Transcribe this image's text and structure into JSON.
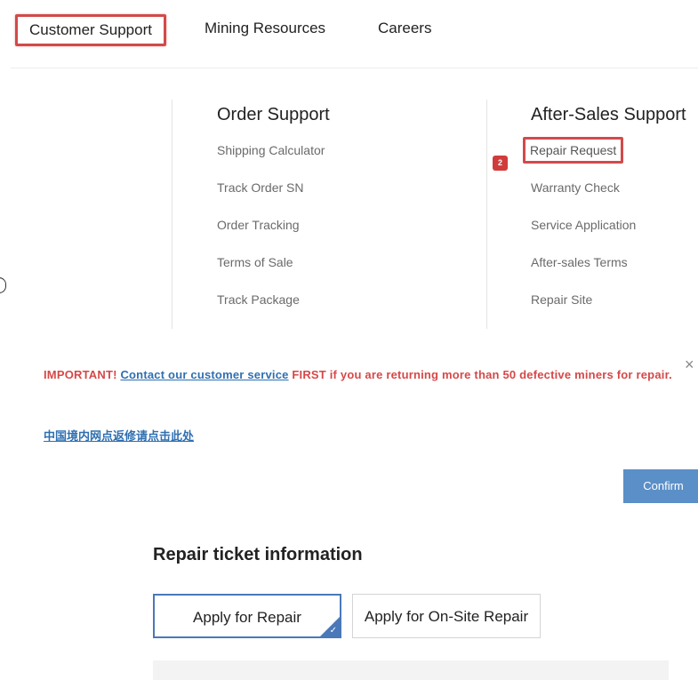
{
  "nav": {
    "items": [
      "Customer Support",
      "Mining Resources",
      "Careers"
    ]
  },
  "menu": {
    "order_support": {
      "title": "Order Support",
      "links": [
        "Shipping Calculator",
        "Track Order SN",
        "Order Tracking",
        "Terms of Sale",
        "Track Package"
      ]
    },
    "after_sales": {
      "title": "After-Sales Support",
      "links": [
        "Repair Request",
        "Warranty Check",
        "Service Application",
        "After-sales Terms",
        "Repair Site"
      ]
    },
    "step_badge": "2"
  },
  "notice": {
    "important_label": "IMPORTANT!",
    "link_text": "Contact our customer service",
    "rest_text": "FIRST if you are returning more than 50 defective miners for repair.",
    "close_glyph": "×",
    "cn_link": "中国境内网点返修请点击此处",
    "confirm_label": "Confirm"
  },
  "repair_ticket": {
    "title": "Repair ticket information",
    "options": [
      "Apply for Repair",
      "Apply for On-Site Repair"
    ],
    "selected_index": 0,
    "check_glyph": "✓"
  },
  "colors": {
    "highlight_red": "#d24a4a",
    "link_blue": "#2f6fb0",
    "confirm_blue": "#5b8fc7",
    "selected_border": "#4a78b8"
  }
}
